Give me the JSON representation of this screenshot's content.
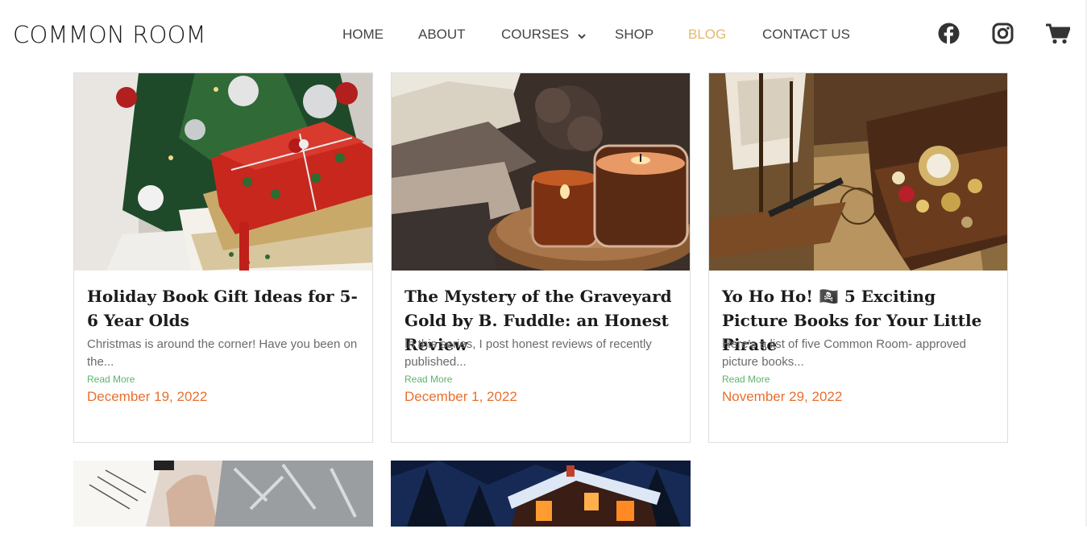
{
  "brand": {
    "logo_text": "COMMON ROOM"
  },
  "nav": {
    "items": [
      {
        "label": "HOME"
      },
      {
        "label": "ABOUT"
      },
      {
        "label": "COURSES"
      },
      {
        "label": "SHOP"
      },
      {
        "label": "BLOG"
      },
      {
        "label": "CONTACT US"
      }
    ],
    "active": "BLOG",
    "social_icons": [
      "facebook-icon",
      "instagram-icon",
      "cart-icon"
    ]
  },
  "colors": {
    "active_nav": "#e3b86c",
    "read_more": "#5fb36a",
    "date": "#e8702e"
  },
  "posts": [
    {
      "title": "Holiday Book Gift Ideas for 5-6 Year Olds",
      "excerpt": "Christmas is around the corner! Have you been on the...",
      "read_more": "Read More",
      "date": "December 19, 2022"
    },
    {
      "title": "The Mystery of the Graveyard Gold by B. Fuddle: an Honest Review",
      "excerpt": "In this series, I post honest reviews of recently published...",
      "read_more": "Read More",
      "date": "December 1, 2022"
    },
    {
      "title": "Yo Ho Ho! 🏴‍☠️ 5 Exciting Picture Books for Your Little Pirate",
      "excerpt": "Here's a list of five Common Room- approved picture books...",
      "read_more": "Read More",
      "date": "November 29, 2022"
    }
  ]
}
